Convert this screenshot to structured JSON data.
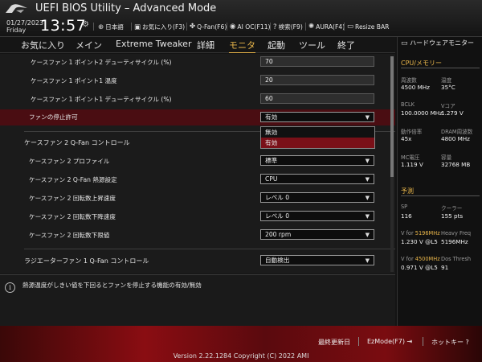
{
  "header": {
    "title": "UEFI BIOS Utility – Advanced Mode",
    "date": "01/27/2023",
    "day": "Friday",
    "time": "13:57",
    "items": [
      {
        "icon": "globe-icon",
        "label": "日本語"
      },
      {
        "icon": "favorite-icon",
        "label": "お気に入り(F3)"
      },
      {
        "icon": "fan-icon",
        "label": "Q-Fan(F6)"
      },
      {
        "icon": "ai-oc-icon",
        "label": "AI OC(F11)"
      },
      {
        "icon": "search-icon",
        "label": "検索(F9)"
      },
      {
        "icon": "aura-icon",
        "label": "AURA(F4)"
      },
      {
        "icon": "resize-bar-icon",
        "label": "Resize BAR"
      }
    ]
  },
  "tabs": [
    "お気に入り",
    "メイン",
    "Extreme Tweaker",
    "詳細",
    "モニタ",
    "起動",
    "ツール",
    "終了"
  ],
  "active_tab": "モニタ",
  "rows": [
    {
      "label": "ケースファン 1 ポイント2 デューティサイクル (%)",
      "value": "70",
      "kind": "input"
    },
    {
      "label": "ケースファン 1 ポイント1 温度",
      "value": "20",
      "kind": "input"
    },
    {
      "label": "ケースファン 1 ポイント1 デューティサイクル (%)",
      "value": "60",
      "kind": "input"
    },
    {
      "label": "ファンの停止許可",
      "value": "有効",
      "kind": "select"
    },
    {
      "label": "ケースファン 2 Q-Fan コントロール",
      "value": "",
      "kind": "header"
    },
    {
      "label": "ケースファン 2 プロファイル",
      "value": "標準",
      "kind": "select"
    },
    {
      "label": "ケースファン 2 Q-Fan 熱源設定",
      "value": "CPU",
      "kind": "select"
    },
    {
      "label": "ケースファン 2 回転数上昇速度",
      "value": "レベル 0",
      "kind": "select"
    },
    {
      "label": "ケースファン 2 回転数下降速度",
      "value": "レベル 0",
      "kind": "select"
    },
    {
      "label": "ケースファン 2 回転数下限値",
      "value": "200 rpm",
      "kind": "select"
    },
    {
      "label": "ラジエーターファン 1 Q-Fan コントロール",
      "value": "自動検出",
      "kind": "select"
    }
  ],
  "dropdown": {
    "options": [
      "無効",
      "有効"
    ],
    "selected": "有効"
  },
  "help": {
    "text": "熱源温度がしきい値を下回るとファンを停止する機能の有効/無効"
  },
  "hw": {
    "title": "ハードウェアモニター",
    "cpu_section": "CPU/メモリー",
    "freq_label": "周波数",
    "freq": "4500 MHz",
    "temp_label": "温度",
    "temp": "35°C",
    "bclk_label": "BCLK",
    "bclk": "100.0000 MHz",
    "vcore_label": "Vコア",
    "vcore": "1.279 V",
    "ratio_label": "動作倍率",
    "ratio": "45x",
    "dram_label": "DRAM周波数",
    "dram": "4800 MHz",
    "mc_label": "MC電圧",
    "mc": "1.119 V",
    "cap_label": "容量",
    "cap": "32768 MB",
    "pred_section": "予測",
    "sp_label": "SP",
    "sp": "116",
    "cooler_label": "クーラー",
    "cooler": "155 pts",
    "vfor1_prefix": "V for ",
    "vfor1_freq": "5196MHz",
    "heavy_label": "Heavy Freq",
    "vfor1_val": "1.230 V @L5",
    "heavy_val": "5196MHz",
    "vfor2_prefix": "V for ",
    "vfor2_freq": "4500MHz",
    "dos_label": "Dos Thresh",
    "vfor2_val": "0.971 V @L5",
    "dos_val": "91"
  },
  "footer": {
    "last_modified": "最終更新日",
    "ezmode": "EzMode(F7)",
    "hotkey": "ホットキー",
    "version": "Version 2.22.1284 Copyright (C) 2022 AMI"
  }
}
